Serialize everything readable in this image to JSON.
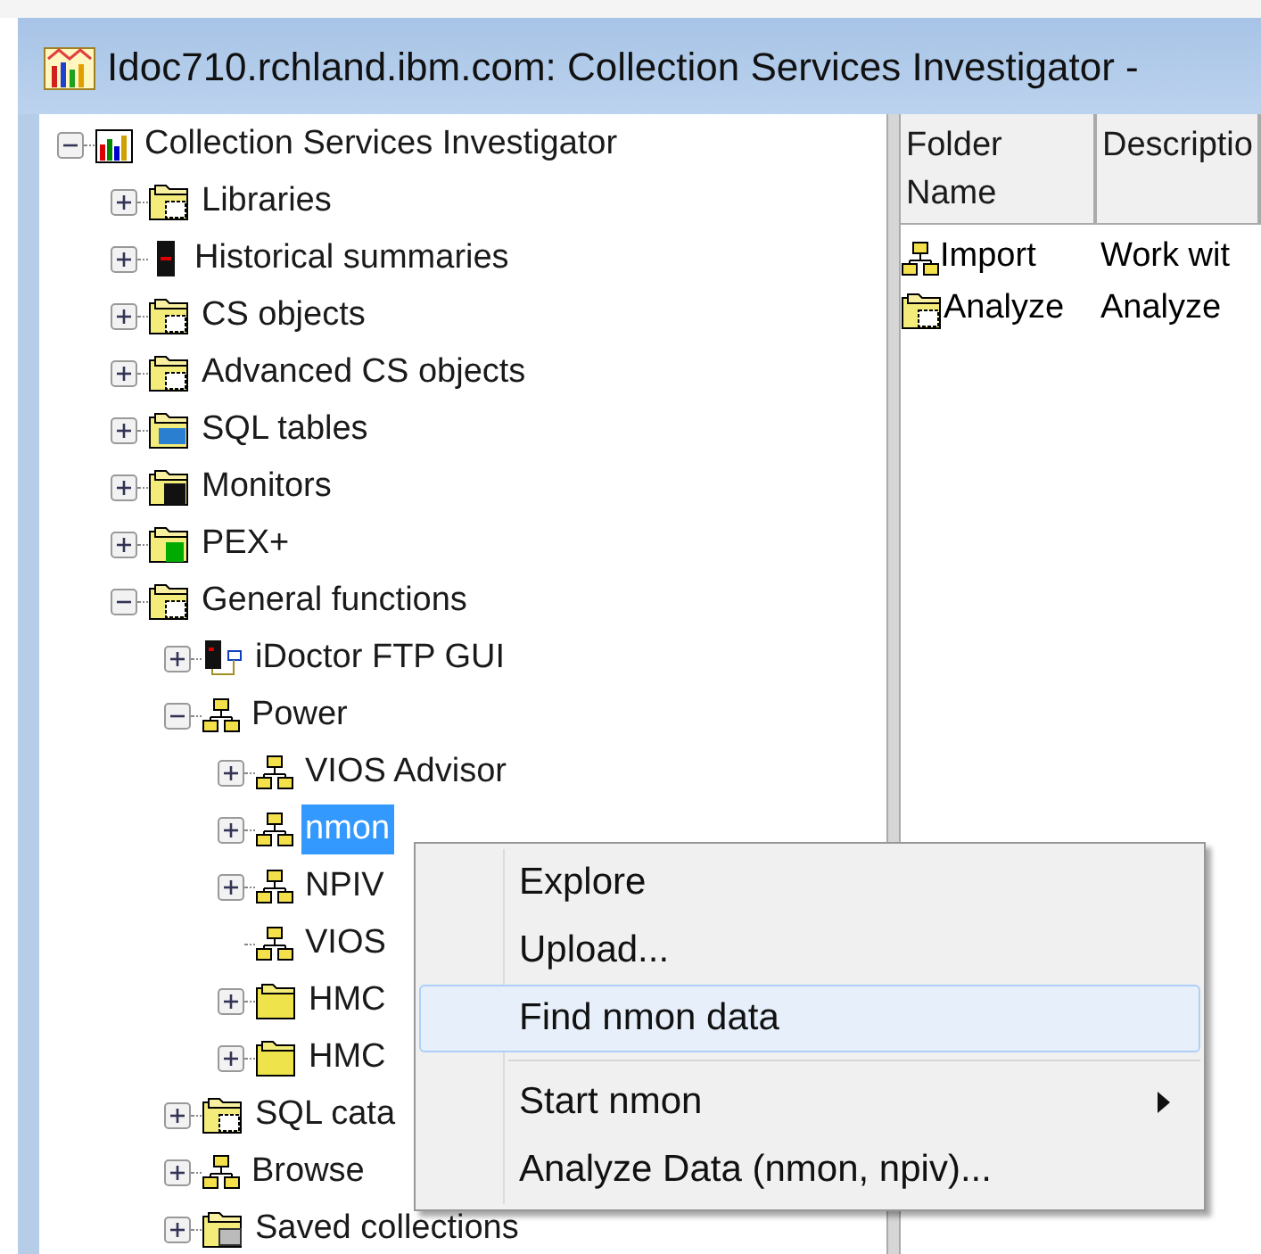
{
  "window": {
    "title": "Idoc710.rchland.ibm.com:  Collection Services Investigator -"
  },
  "tree": [
    {
      "label": "Collection Services Investigator",
      "kind": "chart",
      "expanded": true,
      "selected": false,
      "children": [
        {
          "label": "Libraries",
          "kind": "data-folder",
          "expanded": false,
          "selected": false
        },
        {
          "label": "Historical summaries",
          "kind": "device",
          "expanded": false,
          "selected": false
        },
        {
          "label": "CS objects",
          "kind": "data-folder",
          "expanded": false,
          "selected": false
        },
        {
          "label": "Advanced CS objects",
          "kind": "data-folder",
          "expanded": false,
          "selected": false
        },
        {
          "label": "SQL tables",
          "kind": "table-folder",
          "expanded": false,
          "selected": false
        },
        {
          "label": "Monitors",
          "kind": "monitor-folder",
          "expanded": false,
          "selected": false
        },
        {
          "label": "PEX+",
          "kind": "pex-folder",
          "expanded": false,
          "selected": false
        },
        {
          "label": "General functions",
          "kind": "data-folder",
          "expanded": true,
          "selected": false,
          "children": [
            {
              "label": "iDoctor FTP GUI",
              "kind": "computer",
              "expanded": false,
              "selected": false
            },
            {
              "label": "Power",
              "kind": "network",
              "expanded": true,
              "selected": false,
              "children": [
                {
                  "label": "VIOS Advisor",
                  "kind": "network",
                  "expanded": false,
                  "selected": false
                },
                {
                  "label": "nmon",
                  "kind": "network",
                  "expanded": false,
                  "selected": true
                },
                {
                  "label": "NPIV",
                  "kind": "network",
                  "expanded": false,
                  "selected": false
                },
                {
                  "label": "VIOS",
                  "kind": "network",
                  "selected": false
                },
                {
                  "label": "HMC",
                  "kind": "folder",
                  "expanded": false,
                  "selected": false
                },
                {
                  "label": "HMC",
                  "kind": "folder",
                  "expanded": false,
                  "selected": false
                }
              ]
            },
            {
              "label": "SQL cata",
              "kind": "data-folder",
              "expanded": false,
              "selected": false
            },
            {
              "label": "Browse",
              "kind": "network",
              "expanded": false,
              "selected": false
            },
            {
              "label": "Saved collections",
              "kind": "saved-folder",
              "expanded": false,
              "selected": false
            }
          ]
        }
      ]
    }
  ],
  "list": {
    "columns": [
      "Folder\nName",
      "Descriptio"
    ],
    "rows": [
      {
        "kind": "network",
        "name": "Import",
        "description": "Work wit"
      },
      {
        "kind": "data-folder",
        "name": "Analyze",
        "description": "Analyze"
      }
    ]
  },
  "context_menu": [
    {
      "kind": "item",
      "label": "Explore",
      "selected": false,
      "submenu": false
    },
    {
      "kind": "item",
      "label": "Upload...",
      "selected": false,
      "submenu": false
    },
    {
      "kind": "item",
      "label": "Find nmon data",
      "selected": true,
      "submenu": false
    },
    {
      "kind": "separator"
    },
    {
      "kind": "item",
      "label": "Start nmon",
      "selected": false,
      "submenu": true
    },
    {
      "kind": "item",
      "label": "Analyze Data (nmon, npiv)...",
      "selected": false,
      "submenu": false
    }
  ]
}
